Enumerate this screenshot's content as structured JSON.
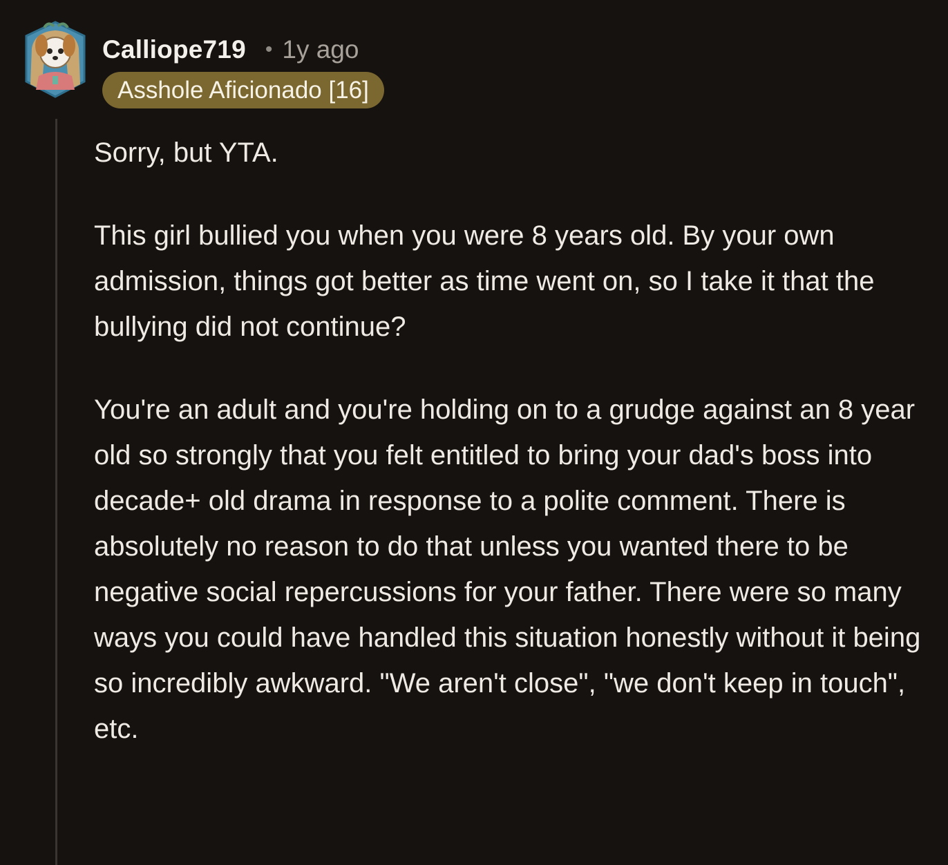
{
  "comment": {
    "username": "Calliope719",
    "separator": "•",
    "age": "1y ago",
    "flair": "Asshole Aficionado [16]",
    "paragraphs": [
      "Sorry, but YTA.",
      "This girl bullied you when you were 8 years old. By your own admission, things got better as time went on, so I take it that the bullying did not continue?",
      "You're an adult and you're holding on to a grudge against an 8 year old so strongly that you felt entitled to bring your dad's boss into decade+ old drama in response to a polite comment. There is absolutely no reason to do that unless you wanted there to be negative social repercussions for your father. There were so many ways you could have handled this situation honestly without it being so incredibly awkward. \"We aren't close\", \"we don't keep in touch\", etc."
    ]
  },
  "colors": {
    "background": "#16120f",
    "flair_background": "#7b6830",
    "thread_line": "#3a3531"
  },
  "icons": {
    "avatar": "user-avatar-snoo"
  }
}
